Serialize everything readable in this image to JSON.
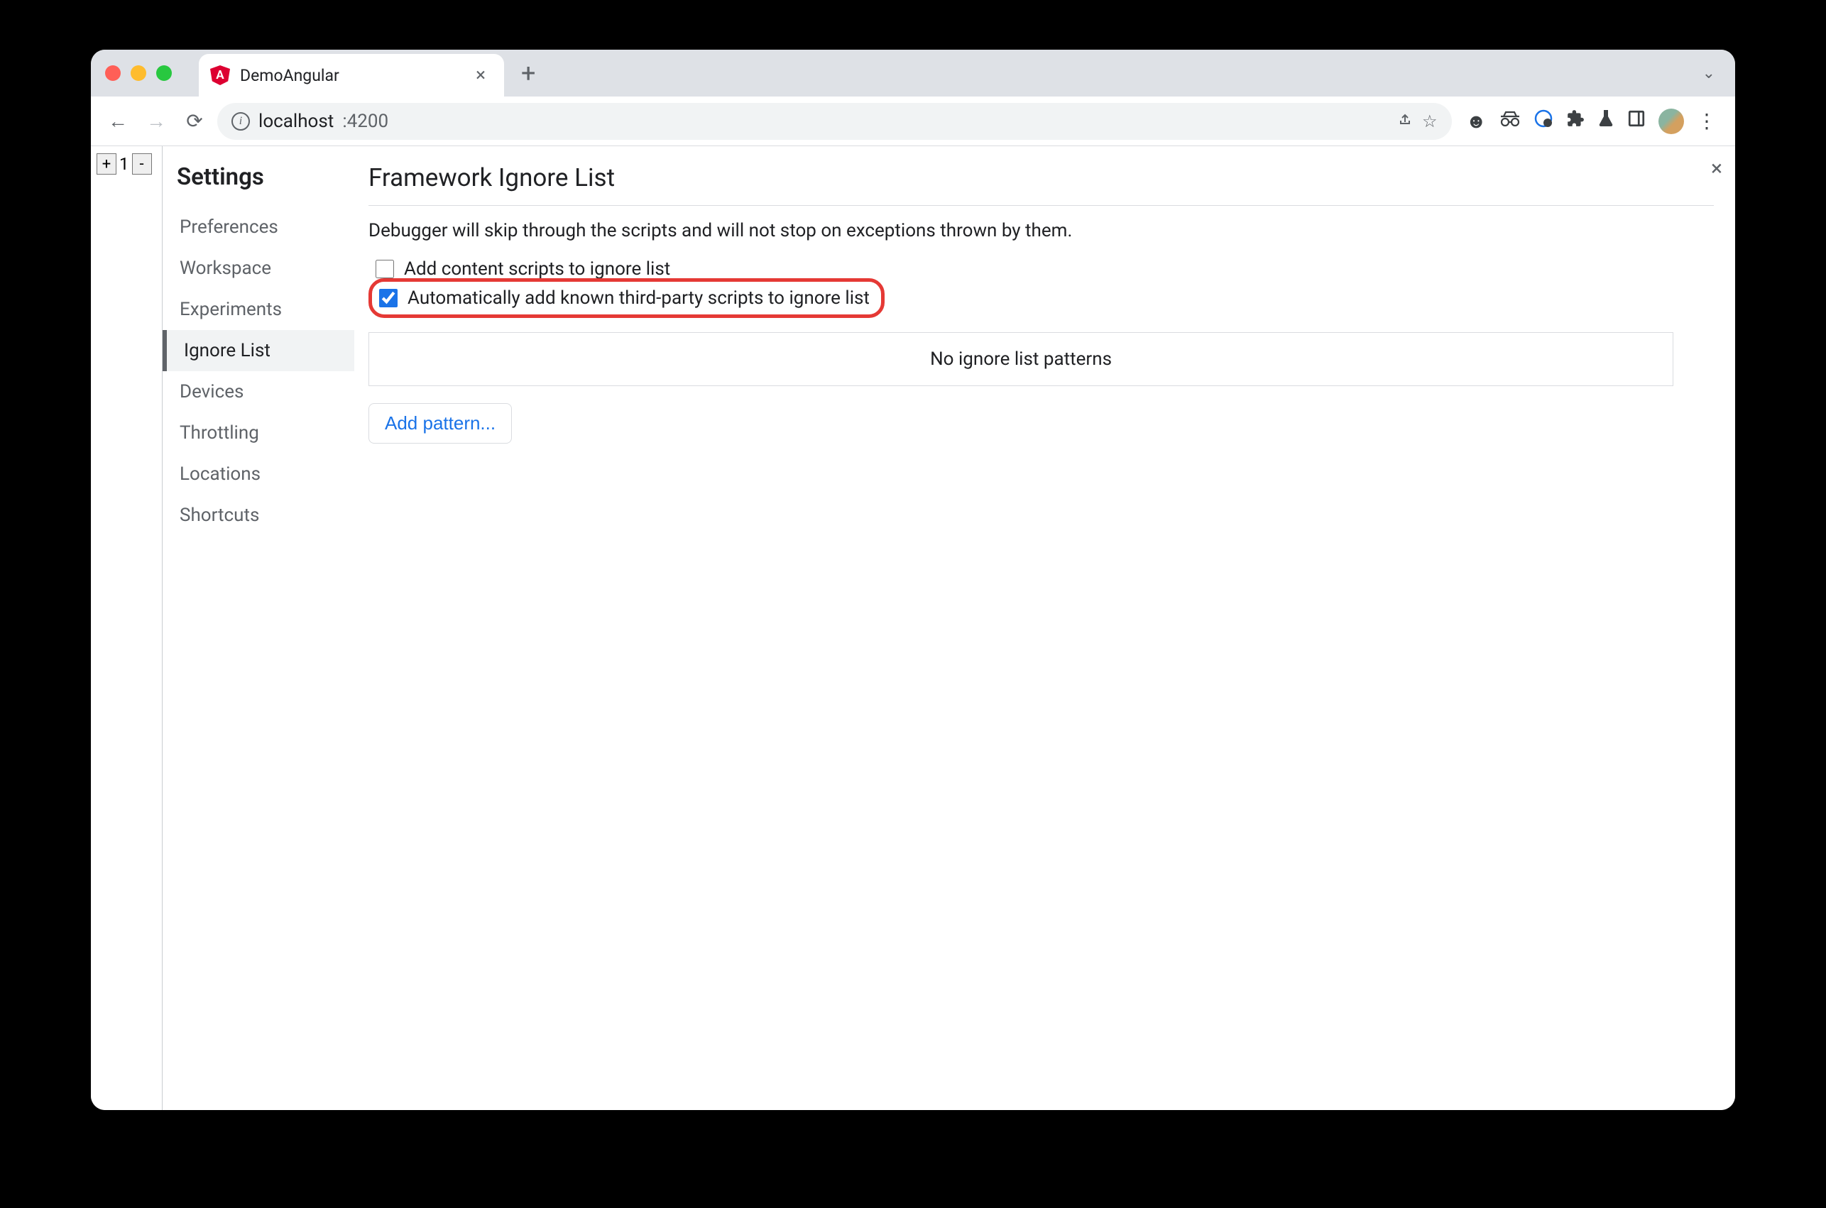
{
  "tab": {
    "title": "DemoAngular"
  },
  "url": {
    "host": "localhost",
    "port": ":4200"
  },
  "page": {
    "counter_value": "1",
    "plus": "+",
    "minus": "-"
  },
  "settings": {
    "title": "Settings",
    "nav": {
      "preferences": "Preferences",
      "workspace": "Workspace",
      "experiments": "Experiments",
      "ignore_list": "Ignore List",
      "devices": "Devices",
      "throttling": "Throttling",
      "locations": "Locations",
      "shortcuts": "Shortcuts"
    }
  },
  "panel": {
    "title": "Framework Ignore List",
    "description": "Debugger will skip through the scripts and will not stop on exceptions thrown by them.",
    "checkbox1_label": "Add content scripts to ignore list",
    "checkbox2_label": "Automatically add known third-party scripts to ignore list",
    "empty_patterns": "No ignore list patterns",
    "add_pattern": "Add pattern...",
    "close": "×"
  }
}
